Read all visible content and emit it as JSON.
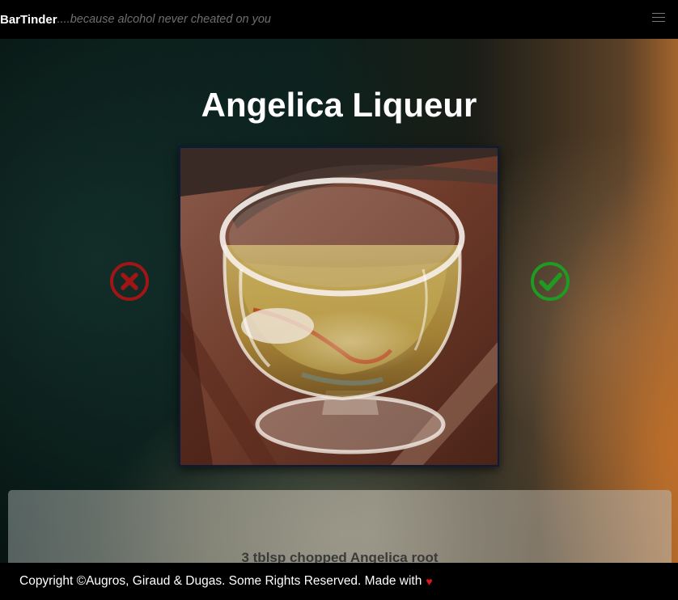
{
  "navbar": {
    "brand": "BarTinder",
    "tagline": "....because alcohol never cheated on you",
    "menu_icon": "hamburger-menu-icon"
  },
  "drink": {
    "name": "Angelica Liqueur",
    "image_alt": "Angelica Liqueur"
  },
  "actions": {
    "reject_icon": "x-circle-icon",
    "accept_icon": "check-circle-icon"
  },
  "ingredients": {
    "items": [
      "3 tblsp chopped Angelica root"
    ]
  },
  "footer": {
    "text": "Copyright ©Augros, Giraud & Dugas. Some Rights Reserved. Made with",
    "heart_icon": "heart-icon"
  },
  "colors": {
    "reject": "#a01616",
    "accept": "#1f9a22",
    "heart": "#e0141e"
  }
}
